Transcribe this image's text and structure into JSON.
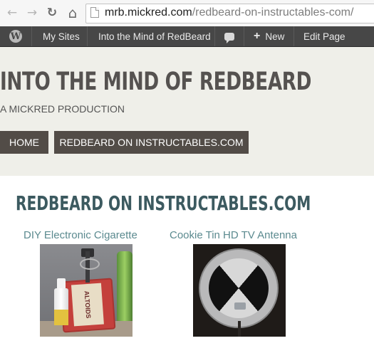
{
  "browser": {
    "url_host": "mrb.mickred.com",
    "url_path": "/redbeard-on-instructables-com/",
    "back_icon": "←",
    "forward_icon": "→",
    "reload_icon": "↻",
    "home_icon": "⌂"
  },
  "adminbar": {
    "my_sites": "My Sites",
    "blog_name": "Into the Mind of RedBeard",
    "new_label": "New",
    "new_plus": "+",
    "edit_page": "Edit Page"
  },
  "site": {
    "title": "INTO THE MIND OF REDBEARD",
    "tagline": "A MICKRED PRODUCTION"
  },
  "menu": {
    "home": "HOME",
    "instructables": "REDBEARD ON INSTRUCTABLES.COM"
  },
  "content": {
    "page_title": "REDBEARD ON INSTRUCTABLES.COM",
    "projects": [
      {
        "title": "DIY Electronic Cigarette",
        "image_text": "ALTOIDS"
      },
      {
        "title": "Cookie Tin HD TV Antenna"
      }
    ]
  },
  "colors": {
    "accent_title": "#3c5a60",
    "link": "#5b8a8f",
    "menu_bg": "#524c47",
    "adminbar_bg": "#474747"
  }
}
